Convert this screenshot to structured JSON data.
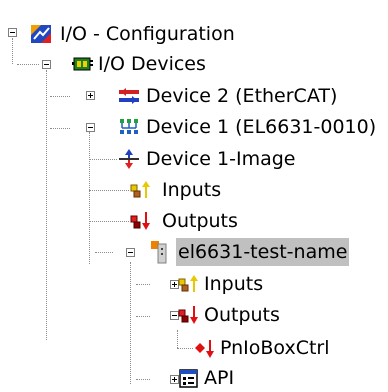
{
  "tree": {
    "root": {
      "label": "I/O - Configuration",
      "icon": "io-configuration-icon"
    },
    "io_devices": {
      "label": "I/O Devices",
      "icon": "io-devices-icon"
    },
    "device2": {
      "label": "Device 2 (EtherCAT)",
      "icon": "ethercat-device-icon"
    },
    "device1": {
      "label": "Device 1 (EL6631-0010)",
      "icon": "profinet-device-icon"
    },
    "device1_image": {
      "label": "Device 1-Image",
      "icon": "process-image-icon"
    },
    "inputs": {
      "label": "Inputs",
      "icon": "inputs-icon"
    },
    "outputs": {
      "label": "Outputs",
      "icon": "outputs-icon"
    },
    "box": {
      "label": "el6631-test-name",
      "icon": "box-icon",
      "selected": true
    },
    "box_inputs": {
      "label": "Inputs",
      "icon": "inputs-icon"
    },
    "box_outputs": {
      "label": "Outputs",
      "icon": "outputs-icon"
    },
    "pnioboxctrl": {
      "label": "PnIoBoxCtrl",
      "icon": "output-variable-icon"
    },
    "api": {
      "label": "API",
      "icon": "api-icon"
    }
  },
  "colors": {
    "selection": "#c0c0c0",
    "tree_lines": "#8c8c8c",
    "output_red": "#e01010",
    "input_yellow": "#e8c800",
    "ethercat_red": "#d42020",
    "ethercat_blue": "#2040c0"
  }
}
